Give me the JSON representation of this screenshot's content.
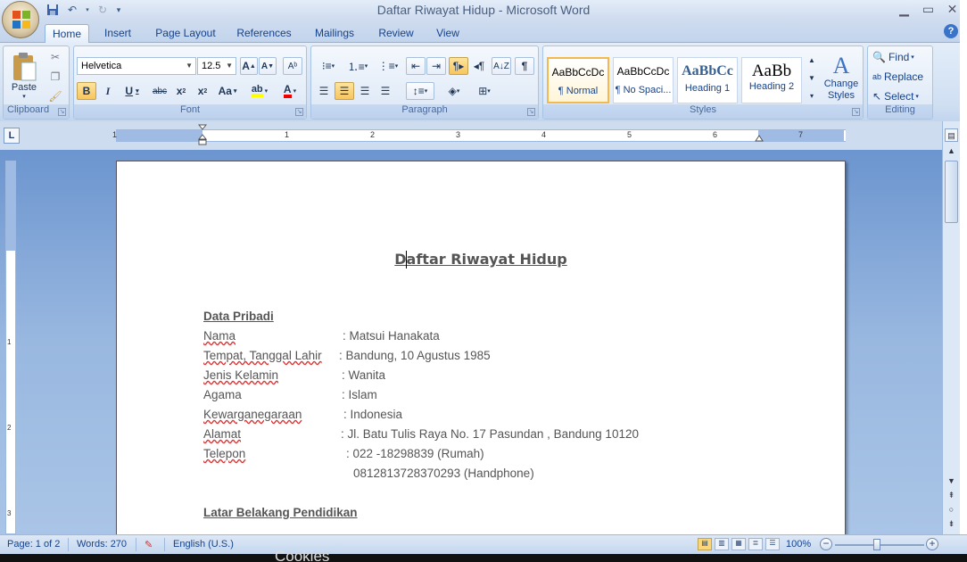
{
  "window": {
    "title": "Daftar Riwayat Hidup - Microsoft Word"
  },
  "tabs": [
    "Home",
    "Insert",
    "Page Layout",
    "References",
    "Mailings",
    "Review",
    "View"
  ],
  "active_tab": "Home",
  "ribbon": {
    "clipboard": {
      "label": "Clipboard",
      "paste": "Paste"
    },
    "font": {
      "label": "Font",
      "font_name": "Helvetica",
      "font_size": "12.5"
    },
    "paragraph": {
      "label": "Paragraph"
    },
    "styles": {
      "label": "Styles",
      "tiles": [
        {
          "sample": "AaBbCcDc",
          "name": "¶ Normal"
        },
        {
          "sample": "AaBbCcDc",
          "name": "¶ No Spaci..."
        },
        {
          "sample": "AaBbCc",
          "name": "Heading 1"
        },
        {
          "sample": "AaBb",
          "name": "Heading 2"
        }
      ],
      "change_styles": "Change Styles"
    },
    "editing": {
      "label": "Editing",
      "find": "Find",
      "replace": "Replace",
      "select": "Select"
    }
  },
  "ruler": {
    "numbers": [
      "1",
      "1",
      "2",
      "3",
      "4",
      "5",
      "6",
      "7"
    ]
  },
  "document": {
    "title": "Daftar Riwayat Hidup",
    "section1": "Data Pribadi",
    "fields": [
      {
        "label": "Nama",
        "value": ": Matsui Hanakata"
      },
      {
        "label": "Tempat, Tanggal Lahir",
        "value": ": Bandung, 10 Agustus 1985"
      },
      {
        "label": "Jenis Kelamin",
        "value": ": Wanita"
      },
      {
        "label": "Agama",
        "value": ": Islam"
      },
      {
        "label": "Kewarganegaraan",
        "value": ": Indonesia"
      },
      {
        "label": "Alamat",
        "value": ": Jl. Batu Tulis Raya No. 17 Pasundan , Bandung 10120"
      },
      {
        "label": "Telepon",
        "value": ": 022 -18298839 (Rumah)"
      },
      {
        "label": "",
        "value": "0812813728370293 (Handphone)"
      }
    ],
    "section2": "Latar Belakang Pendidikan"
  },
  "status": {
    "page": "Page: 1 of 2",
    "words": "Words: 270",
    "language": "English (U.S.)",
    "zoom": "100%"
  },
  "below_text": "Cookies"
}
